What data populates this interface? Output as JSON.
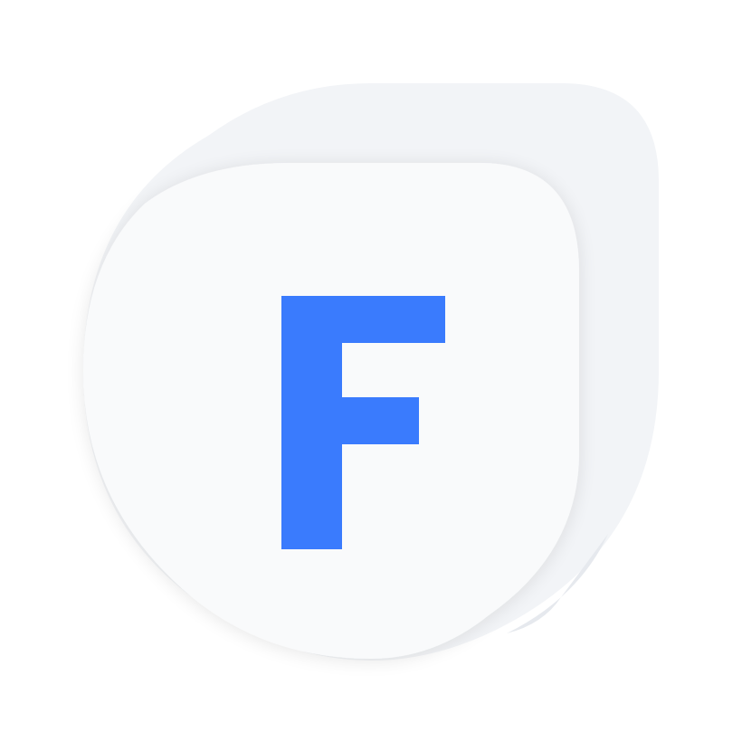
{
  "logo": {
    "name": "app-logo",
    "letter": "F",
    "colors": {
      "background": "#ffffff",
      "back_leaf": "#f2f4f7",
      "back_leaf_edge": "#e6e9ee",
      "front_leaf": "#f9fafb",
      "letter": "#3a7bfd"
    }
  }
}
